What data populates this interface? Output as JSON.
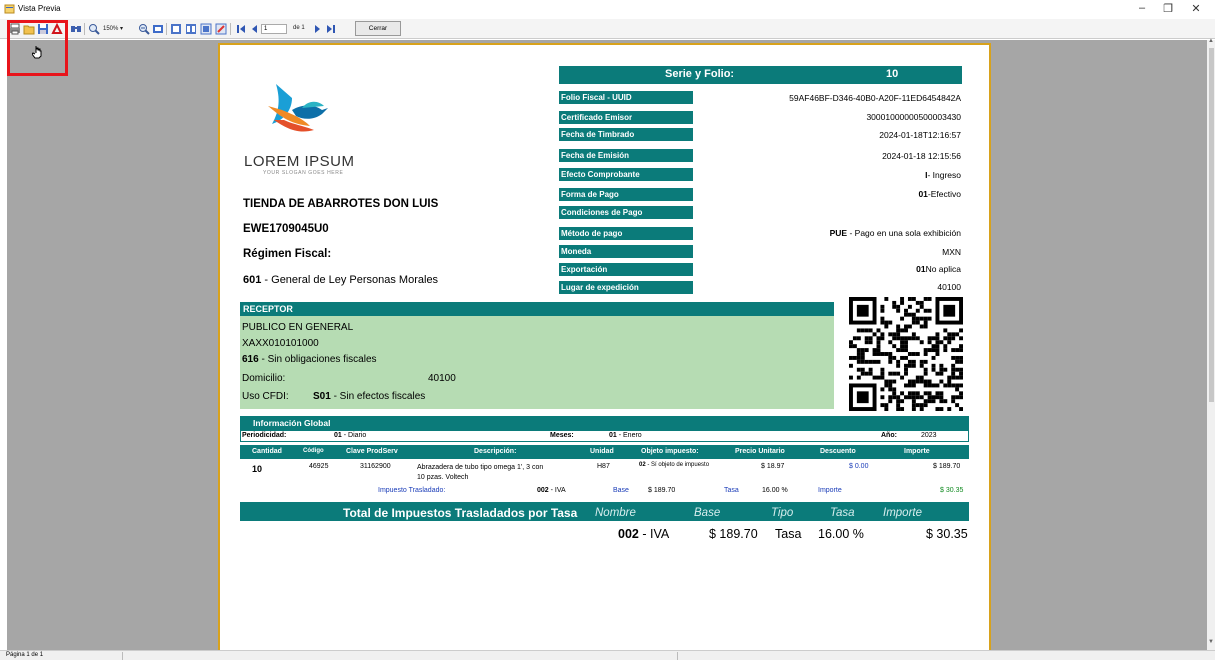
{
  "window": {
    "title": "Vista Previa",
    "minimize": "–",
    "maximize": "❐",
    "close": "✕"
  },
  "toolbar": {
    "zoom_label": "150% ▾",
    "page_current": "1",
    "page_of": "de 1",
    "close_label": "Cerrar"
  },
  "status": {
    "page_text": "Página 1 de 1"
  },
  "logo": {
    "name": "LOREM IPSUM",
    "slogan": "YOUR SLOGAN GOES HERE"
  },
  "company": {
    "name": "TIENDA DE ABARROTES DON LUIS",
    "rfc": "EWE1709045U0",
    "regimen_title": "Régimen Fiscal:",
    "regimen_code": "601",
    "regimen_desc": " - General de Ley Personas Morales"
  },
  "header": {
    "serie_label": "Serie y Folio:",
    "serie_value": "10",
    "rows": [
      {
        "label": "Folio Fiscal - UUID",
        "value_bold": "",
        "value": "59AF46BF-D346-40B0-A20F-11ED6454842A"
      },
      {
        "label": "Certificado Emisor",
        "value_bold": "",
        "value": "30001000000500003430"
      },
      {
        "label": "Fecha de Timbrado",
        "value_bold": "",
        "value": "2024-01-18T12:16:57"
      },
      {
        "label": "Fecha de Emisión",
        "value_bold": "",
        "value": "2024-01-18  12:15:56"
      },
      {
        "label": "Efecto Comprobante",
        "value_bold": "I",
        "value": "- Ingreso"
      },
      {
        "label": "Forma de Pago",
        "value_bold": "01",
        "value": "-Efectivo"
      },
      {
        "label": "Condiciones de Pago",
        "value_bold": "",
        "value": ""
      },
      {
        "label": "Método de pago",
        "value_bold": "PUE",
        "value": " - Pago en una sola exhibición"
      },
      {
        "label": "Moneda",
        "value_bold": "",
        "value": "MXN"
      },
      {
        "label": "Exportación",
        "value_bold": "01",
        "value": "No aplica"
      },
      {
        "label": "Lugar de expedición",
        "value_bold": "",
        "value": "40100"
      }
    ]
  },
  "receptor": {
    "title": "RECEPTOR",
    "name": "PUBLICO EN GENERAL",
    "rfc": "XAXX010101000",
    "regimen_code": "616",
    "regimen_desc": " - Sin obligaciones fiscales",
    "domicilio_label": "Domicilio:",
    "domicilio_value": "40100",
    "uso_label": "Uso CFDI:",
    "uso_code": "S01",
    "uso_desc": " - Sin efectos fiscales"
  },
  "global_info": {
    "title": "Información Global",
    "periodicidad_label": "Periodicidad:",
    "periodicidad_code": "01",
    "periodicidad_desc": " - Diario",
    "meses_label": "Meses:",
    "meses_code": "01",
    "meses_desc": " - Enero",
    "anio_label": "Año:",
    "anio_value": "2023"
  },
  "items_table": {
    "headers": [
      "Cantidad",
      "Código",
      "Clave ProdServ",
      "Descripción:",
      "Unidad",
      "Objeto impuesto:",
      "Precio Unitario",
      "Descuento",
      "Importe"
    ],
    "row": {
      "cantidad": "10",
      "codigo": "46925",
      "clave": "31162900",
      "desc_line1": "Abrazadera de tubo tipo omega 1', 3 con",
      "desc_line2": "10 pzas. Voltech",
      "unidad": "H87",
      "objeto_code": "02",
      "objeto_desc": " - Sí objeto de impuesto",
      "precio": "$ 18.97",
      "descuento": "$ 0.00",
      "importe": "$ 189.70"
    },
    "tax": {
      "label": "Impuesto Trasladado:",
      "code": "002",
      "name": " - IVA",
      "base_label": "Base",
      "base_value": "$ 189.70",
      "tasa_label": "Tasa",
      "tasa_value": "16.00 %",
      "importe_label": "Importe",
      "importe_value": "$ 30.35"
    }
  },
  "totals": {
    "title": "Total de Impuestos Trasladados por Tasa",
    "headers": [
      "Nombre",
      "Base",
      "Tipo",
      "Tasa",
      "Importe"
    ],
    "code": "002",
    "name": " - IVA",
    "base": "$ 189.70",
    "tipo": "Tasa",
    "tasa": "16.00 %",
    "importe": "$ 30.35"
  },
  "colors": {
    "teal": "#0b7b7a",
    "receptor_bg": "#b6dcb3",
    "page_border": "#d8a21c",
    "highlight": "#e8141b"
  }
}
